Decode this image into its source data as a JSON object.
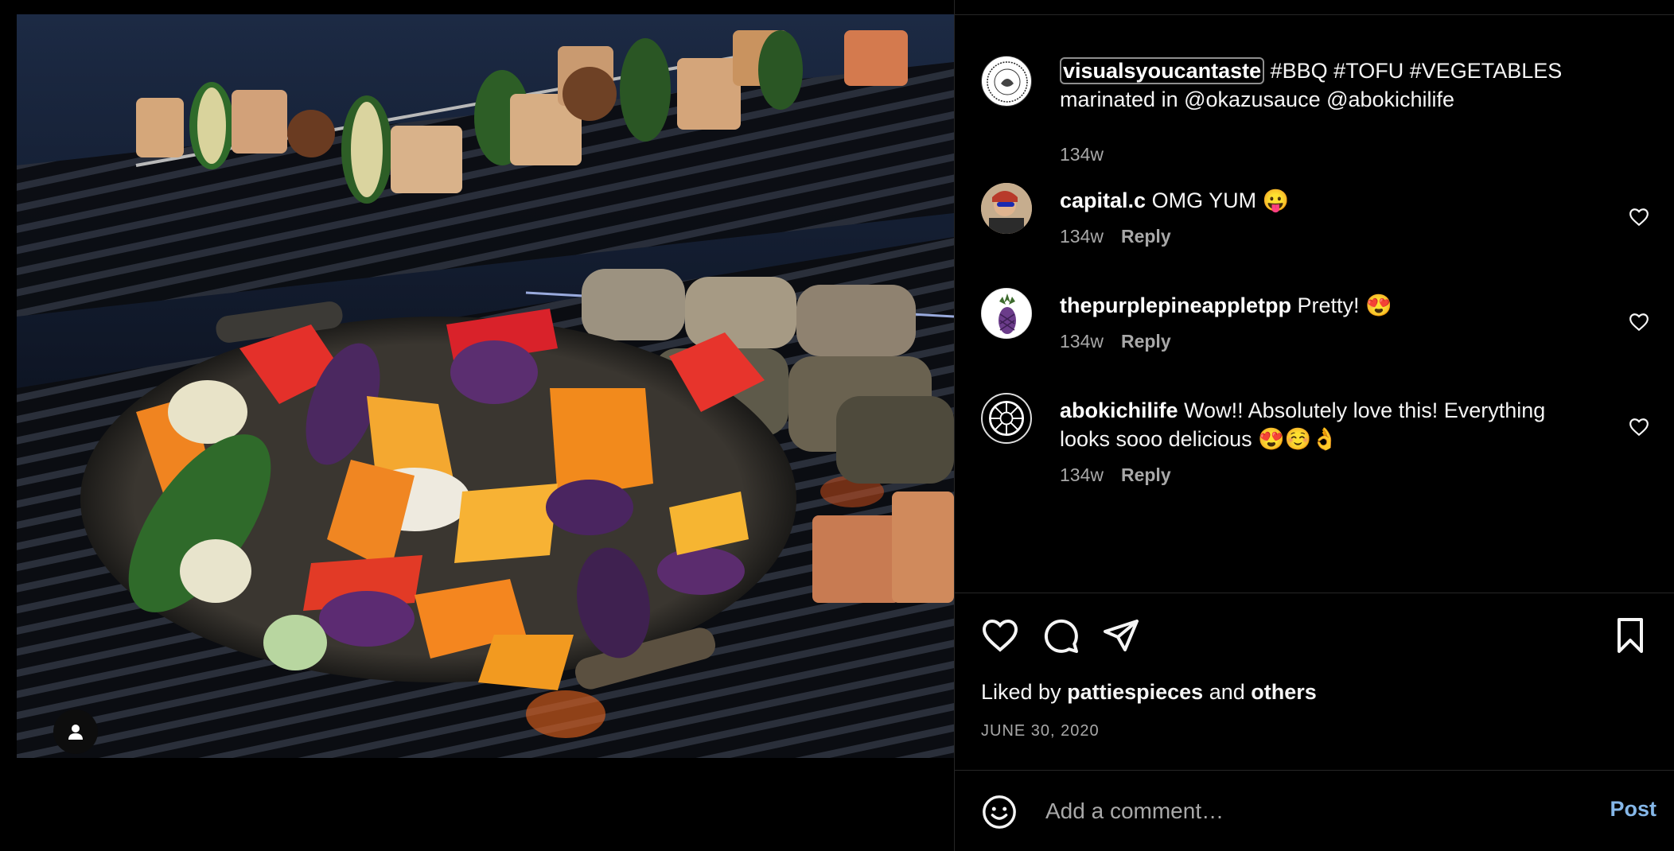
{
  "post": {
    "author": "visualsyoucantaste",
    "caption": "#BBQ #TOFU #VEGETABLES marinated in @okazusauce @abokichilife",
    "age": "134w"
  },
  "comments": [
    {
      "user": "capital.c",
      "text": "OMG YUM 😛",
      "age": "134w",
      "reply_label": "Reply"
    },
    {
      "user": "thepurplepineappletpp",
      "text": "Pretty! 😍",
      "age": "134w",
      "reply_label": "Reply"
    },
    {
      "user": "abokichilife",
      "text": "Wow!! Absolutely love this! Everything looks sooo delicious 😍☺️👌",
      "age": "134w",
      "reply_label": "Reply"
    }
  ],
  "likes": {
    "prefix": "Liked by",
    "user": "pattiespieces",
    "joiner": "and",
    "others": "others"
  },
  "date": "JUNE 30, 2020",
  "composer": {
    "placeholder": "Add a comment…",
    "post_label": "Post"
  },
  "icons": {
    "like": "heart-icon",
    "comment": "speech-bubble-icon",
    "share": "paper-plane-icon",
    "save": "bookmark-icon",
    "emoji": "smiley-icon",
    "user_tag": "person-icon"
  },
  "colors": {
    "background": "#000000",
    "divider": "#262626",
    "secondary_text": "#a8a8a8",
    "post_button": "#85b7e8"
  }
}
